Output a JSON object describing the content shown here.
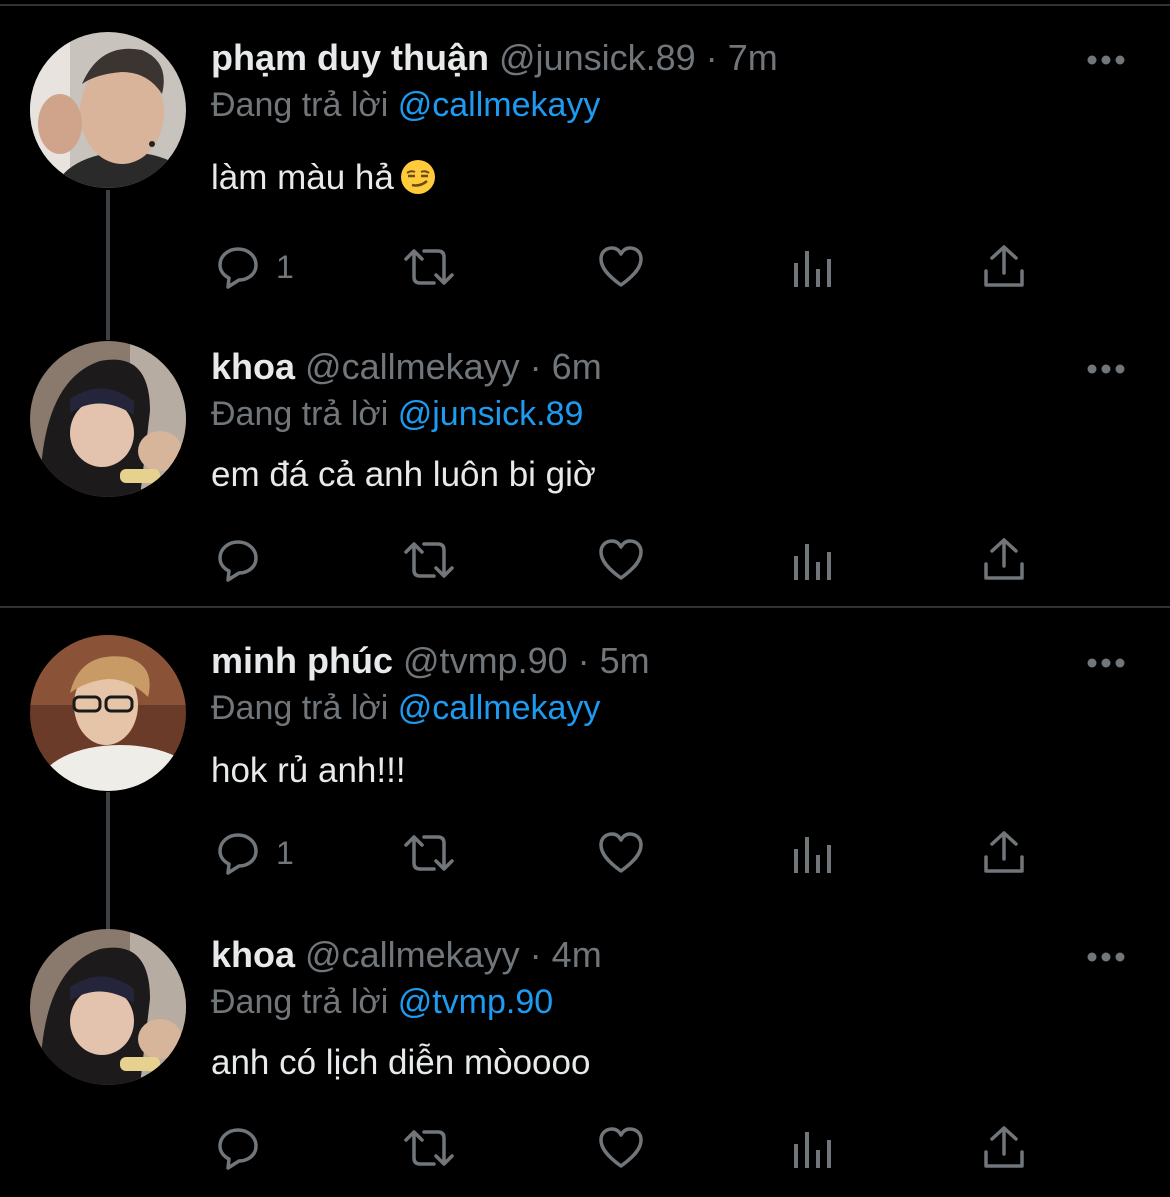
{
  "tweets": [
    {
      "name": "phạm duy thuận",
      "handle": "@junsick.89",
      "separator": "·",
      "time": "7m",
      "replying_label": "Đang trả lời",
      "replying_to": "@callmekayy",
      "text": "làm màu hả",
      "emoji_icon": "smirking-face-icon",
      "reply_count": "1"
    },
    {
      "name": "khoa",
      "handle": "@callmekayy",
      "separator": "·",
      "time": "6m",
      "replying_label": "Đang trả lời",
      "replying_to": "@junsick.89",
      "text": "em đá cả anh luôn bi giờ",
      "reply_count": ""
    },
    {
      "name": "minh phúc",
      "handle": "@tvmp.90",
      "separator": "·",
      "time": "5m",
      "replying_label": "Đang trả lời",
      "replying_to": "@callmekayy",
      "text": "hok rủ anh!!!",
      "reply_count": "1"
    },
    {
      "name": "khoa",
      "handle": "@callmekayy",
      "separator": "·",
      "time": "4m",
      "replying_label": "Đang trả lời",
      "replying_to": "@tvmp.90",
      "text": "anh có lịch diễn mòoooo",
      "reply_count": ""
    }
  ],
  "icons": {
    "reply": "reply-icon",
    "retweet": "retweet-icon",
    "like": "heart-icon",
    "views": "analytics-icon",
    "share": "share-icon",
    "more": "more-options-icon"
  },
  "colors": {
    "background": "#000000",
    "text": "#e7e9ea",
    "secondary": "#71767b",
    "accent": "#1d9bf0",
    "divider": "#2f3336"
  }
}
